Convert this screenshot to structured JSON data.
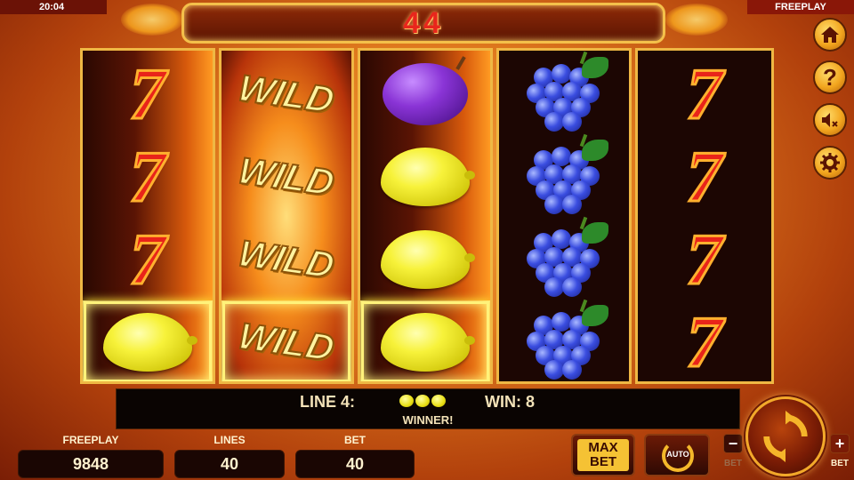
{
  "status": {
    "time": "20:04",
    "mode": "FREEPLAY"
  },
  "win_display": "44",
  "reels": [
    [
      "seven",
      "seven",
      "seven",
      "lemon"
    ],
    [
      "wild",
      "wild",
      "wild",
      "wild"
    ],
    [
      "plum",
      "lemon",
      "lemon",
      "lemon"
    ],
    [
      "grapes",
      "grapes",
      "grapes",
      "grapes"
    ],
    [
      "seven",
      "seven",
      "seven",
      "seven"
    ]
  ],
  "symbol_text": {
    "wild": "WILD",
    "seven": "7"
  },
  "highlighted_row": 3,
  "highlighted_reels": [
    0,
    1,
    2
  ],
  "info": {
    "line": "LINE 4:",
    "win": "WIN: 8",
    "message": "WINNER!"
  },
  "stats": {
    "freeplay_label": "FREEPLAY",
    "freeplay_value": "9848",
    "lines_label": "LINES",
    "lines_value": "40",
    "bet_label": "BET",
    "bet_value": "40"
  },
  "buttons": {
    "max_bet": "MAX\nBET",
    "auto": "AUTO",
    "bet_minus_symbol": "−",
    "bet_minus_label": "BET",
    "bet_plus_symbol": "+",
    "bet_plus_label": "BET"
  },
  "side_buttons": [
    "home-icon",
    "help-icon",
    "sound-muted-icon",
    "gear-icon"
  ],
  "colors": {
    "frame_gold": "#efb844",
    "highlight": "#fff27a",
    "seven_red": "#e9241a"
  }
}
